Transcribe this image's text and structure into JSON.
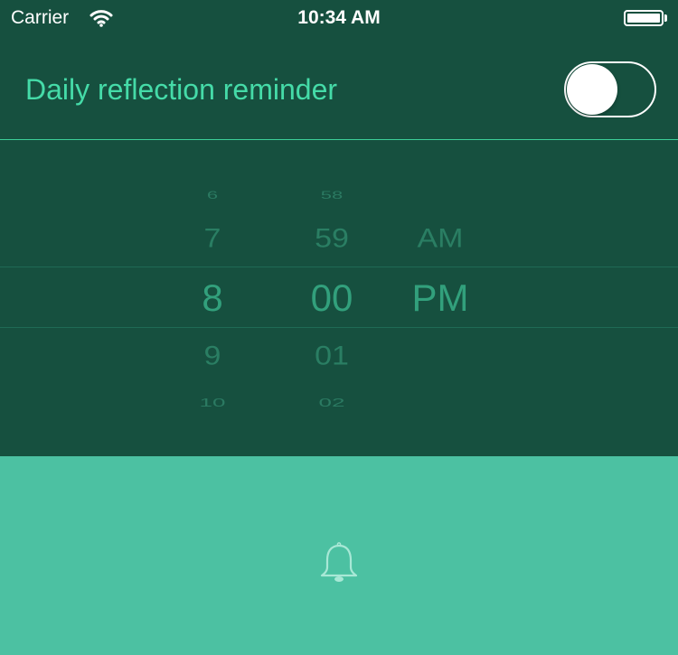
{
  "status_bar": {
    "carrier": "Carrier",
    "time": "10:34 AM",
    "icons": [
      "wifi-icon",
      "battery-icon"
    ]
  },
  "reminder": {
    "label": "Daily reflection reminder",
    "toggle_on": false
  },
  "time_picker": {
    "hours": {
      "far_above": "6",
      "above": "7",
      "selected": "8",
      "below": "9",
      "far_below": "10"
    },
    "minutes": {
      "far_above": "58",
      "above": "59",
      "selected": "00",
      "below": "01",
      "far_below": "02"
    },
    "period": {
      "above": "AM",
      "selected": "PM"
    }
  },
  "bottom": {
    "icon": "bell-icon"
  },
  "colors": {
    "background": "#16503f",
    "accent_text": "#45dba8",
    "divider": "#3ccf99",
    "picker_selected": "#32a07c",
    "bottom_panel": "#4cc1a2"
  }
}
